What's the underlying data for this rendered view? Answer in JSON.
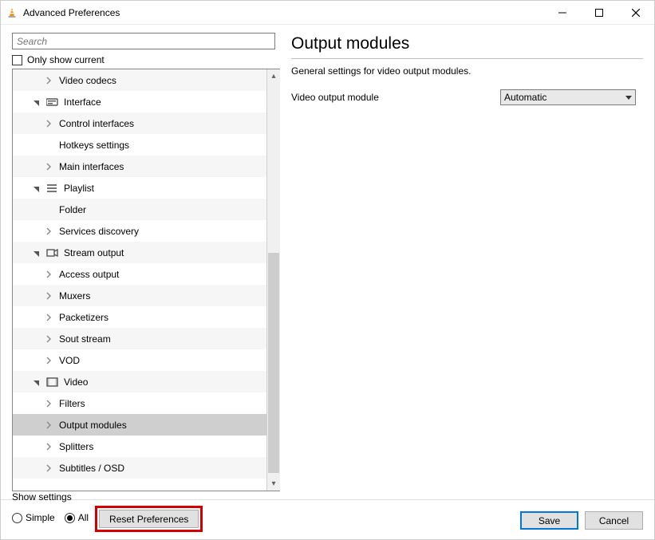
{
  "window": {
    "title": "Advanced Preferences"
  },
  "search": {
    "placeholder": "Search"
  },
  "only_show_current": "Only show current",
  "tree": {
    "items": [
      {
        "label": "Video codecs",
        "type": "child"
      },
      {
        "label": "Interface",
        "type": "category",
        "icon": "interface"
      },
      {
        "label": "Control interfaces",
        "type": "child"
      },
      {
        "label": "Hotkeys settings",
        "type": "leaf"
      },
      {
        "label": "Main interfaces",
        "type": "child"
      },
      {
        "label": "Playlist",
        "type": "category",
        "icon": "playlist"
      },
      {
        "label": "Folder",
        "type": "leaf"
      },
      {
        "label": "Services discovery",
        "type": "child"
      },
      {
        "label": "Stream output",
        "type": "category",
        "icon": "stream"
      },
      {
        "label": "Access output",
        "type": "child"
      },
      {
        "label": "Muxers",
        "type": "child"
      },
      {
        "label": "Packetizers",
        "type": "child"
      },
      {
        "label": "Sout stream",
        "type": "child"
      },
      {
        "label": "VOD",
        "type": "child"
      },
      {
        "label": "Video",
        "type": "category",
        "icon": "video"
      },
      {
        "label": "Filters",
        "type": "child"
      },
      {
        "label": "Output modules",
        "type": "child",
        "selected": true
      },
      {
        "label": "Splitters",
        "type": "child"
      },
      {
        "label": "Subtitles / OSD",
        "type": "child"
      }
    ]
  },
  "main": {
    "title": "Output modules",
    "description": "General settings for video output modules.",
    "field_label": "Video output module",
    "field_value": "Automatic"
  },
  "footer": {
    "show_settings": "Show settings",
    "simple": "Simple",
    "all": "All",
    "reset": "Reset Preferences",
    "save": "Save",
    "cancel": "Cancel"
  }
}
